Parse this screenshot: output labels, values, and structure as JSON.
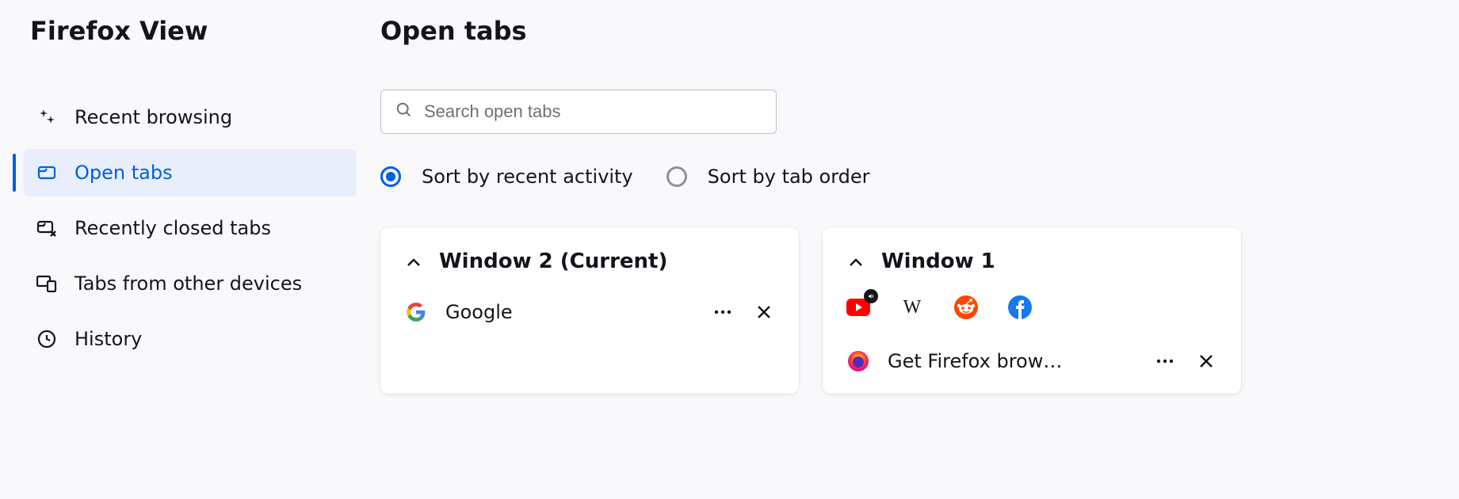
{
  "sidebar": {
    "title": "Firefox View",
    "items": [
      {
        "label": "Recent browsing",
        "icon": "sparkle-icon",
        "active": false
      },
      {
        "label": "Open tabs",
        "icon": "tab-icon",
        "active": true
      },
      {
        "label": "Recently closed tabs",
        "icon": "tab-close-icon",
        "active": false
      },
      {
        "label": "Tabs from other devices",
        "icon": "devices-icon",
        "active": false
      },
      {
        "label": "History",
        "icon": "history-icon",
        "active": false
      }
    ]
  },
  "main": {
    "title": "Open tabs",
    "search_placeholder": "Search open tabs",
    "sort": {
      "option_a": "Sort by recent activity",
      "option_b": "Sort by tab order",
      "selected": "a"
    },
    "windows": [
      {
        "title": "Window 2 (Current)",
        "tabs": [
          {
            "title": "Google",
            "favicon": "google"
          }
        ]
      },
      {
        "title": "Window 1",
        "favicons_preview": [
          "youtube",
          "wikipedia",
          "reddit",
          "facebook"
        ],
        "audio_indicator_on_first": true,
        "tabs": [
          {
            "title": "Get Firefox brow…",
            "favicon": "firefox"
          }
        ]
      }
    ]
  }
}
